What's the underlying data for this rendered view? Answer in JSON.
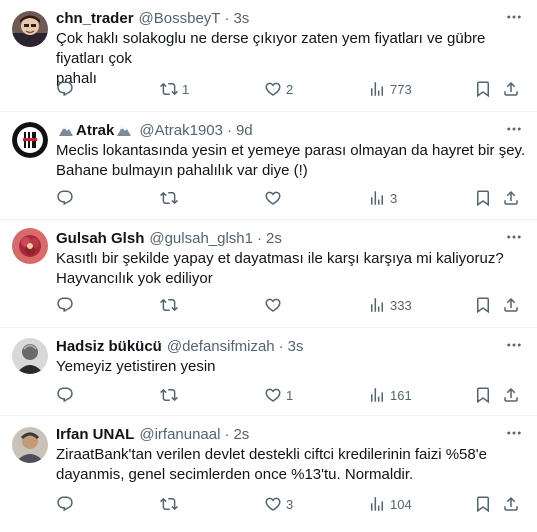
{
  "tweets": [
    {
      "name": "chn_trader",
      "handle": "@BossbeyT",
      "time": "3s",
      "text": "Çok haklı solakoglu ne derse çıkıyor zaten yem fiyatları ve gübre fiyatları çok\npahalı",
      "replies": "",
      "retweets": "1",
      "likes": "2",
      "views": "773",
      "avatar": "cartoon-avatar"
    },
    {
      "name": "Atrak",
      "handle": "@Atrak1903",
      "time": "9d",
      "text": "Meclis lokantasında yesin et yemeye parası olmayan da hayret bir şey.\nBahane bulmayın pahalılık var diye (!)",
      "replies": "",
      "retweets": "",
      "likes": "",
      "views": "3",
      "avatar": "besiktas-crest-avatar"
    },
    {
      "name": "Gulsah Glsh",
      "handle": "@gulsah_glsh1",
      "time": "2s",
      "text": "Kasıtlı bir şekilde yapay et dayatması ile karşı karşıya mi kaliyoruz?\nHayvancılık yok ediliyor",
      "replies": "",
      "retweets": "",
      "likes": "",
      "views": "333",
      "avatar": "flower-avatar"
    },
    {
      "name": "Hadsiz bükücü",
      "handle": "@defansifmizah",
      "time": "3s",
      "text": "Yemeyiz yetistiren yesin",
      "replies": "",
      "retweets": "",
      "likes": "1",
      "views": "161",
      "avatar": "portrait-avatar"
    },
    {
      "name": "Irfan UNAL",
      "handle": "@irfanunaal",
      "time": "2s",
      "text": "ZiraatBank'tan verilen devlet destekli ciftci kredilerinin faizi %58'e\ndayanmis, genel secimlerden once %13'tu. Normaldir.",
      "replies": "",
      "retweets": "",
      "likes": "3",
      "views": "104",
      "avatar": "photo-avatar"
    }
  ],
  "colors": {
    "text": "#0f1419",
    "secondary": "#536471",
    "divider": "#eff3f4"
  }
}
